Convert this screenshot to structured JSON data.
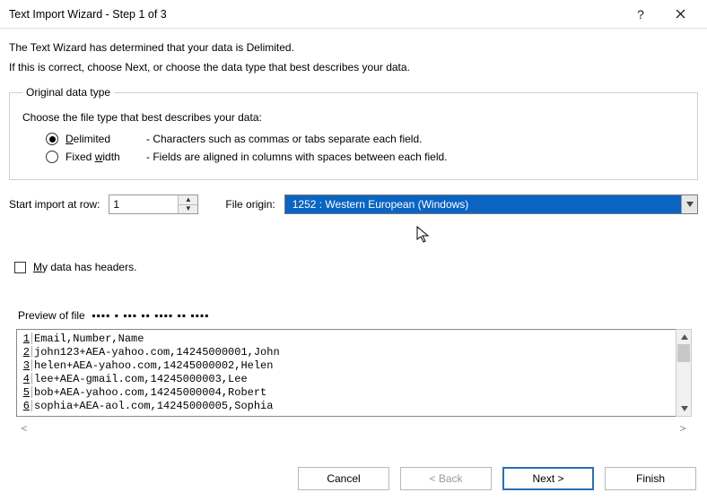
{
  "title": "Text Import Wizard - Step 1 of 3",
  "intro1": "The Text Wizard has determined that your data is Delimited.",
  "intro2": "If this is correct, choose Next, or choose the data type that best describes your data.",
  "orig": {
    "legend": "Original data type",
    "choose": "Choose the file type that best describes your data:",
    "delimited_label": "Delimited",
    "delimited_desc": "- Characters such as commas or tabs separate each field.",
    "fixed_label": "Fixed width",
    "fixed_desc": "- Fields are aligned in columns with spaces between each field."
  },
  "row_import": {
    "start_label": "Start import at row:",
    "start_value": "1",
    "origin_label": "File origin:",
    "origin_value": "1252 : Western European (Windows)"
  },
  "headers_label": "My data has headers.",
  "preview_label": "Preview of file",
  "preview_lines": [
    "Email,Number,Name",
    "john123+AEA-yahoo.com,14245000001,John",
    "helen+AEA-yahoo.com,14245000002,Helen",
    "lee+AEA-gmail.com,14245000003,Lee",
    "bob+AEA-yahoo.com,14245000004,Robert",
    "sophia+AEA-aol.com,14245000005,Sophia"
  ],
  "buttons": {
    "cancel": "Cancel",
    "back": "< Back",
    "next": "Next >",
    "finish": "Finish"
  }
}
